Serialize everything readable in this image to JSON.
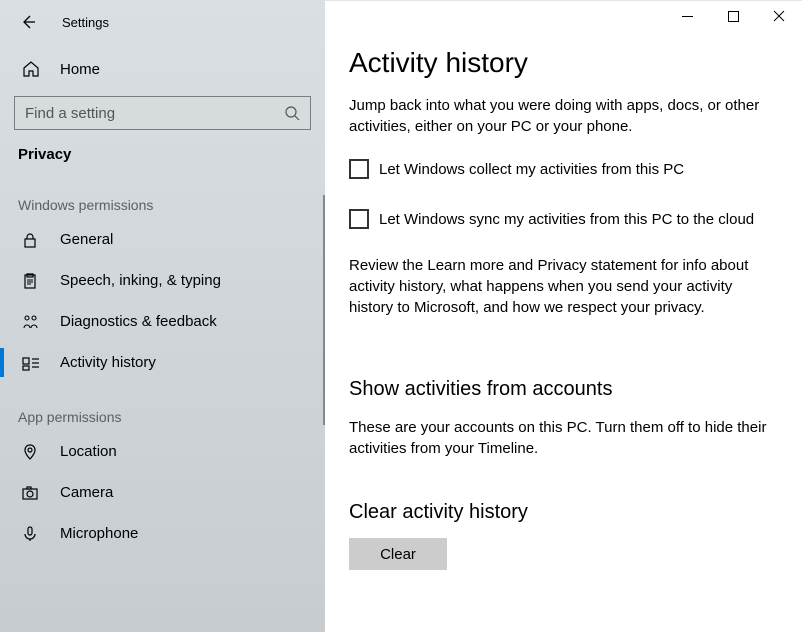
{
  "window": {
    "title": "Settings"
  },
  "sidebar": {
    "home_label": "Home",
    "search_placeholder": "Find a setting",
    "category": "Privacy",
    "groups": [
      {
        "label": "Windows permissions",
        "items": [
          {
            "icon": "lock-icon",
            "label": "General",
            "selected": false
          },
          {
            "icon": "clipboard-icon",
            "label": "Speech, inking, & typing",
            "selected": false
          },
          {
            "icon": "feedback-icon",
            "label": "Diagnostics & feedback",
            "selected": false
          },
          {
            "icon": "activity-icon",
            "label": "Activity history",
            "selected": true
          }
        ]
      },
      {
        "label": "App permissions",
        "items": [
          {
            "icon": "location-icon",
            "label": "Location",
            "selected": false
          },
          {
            "icon": "camera-icon",
            "label": "Camera",
            "selected": false
          },
          {
            "icon": "microphone-icon",
            "label": "Microphone",
            "selected": false
          }
        ]
      }
    ]
  },
  "main": {
    "heading": "Activity history",
    "intro": "Jump back into what you were doing with apps, docs, or other activities, either on your PC or your phone.",
    "check1": "Let Windows collect my activities from this PC",
    "check2": "Let Windows sync my activities from this PC to the cloud",
    "review": "Review the Learn more and Privacy statement for info about activity history, what happens when you send your activity history to Microsoft, and how we respect your privacy.",
    "accounts_heading": "Show activities from accounts",
    "accounts_text": "These are your accounts on this PC. Turn them off to hide their activities from your Timeline.",
    "clear_heading": "Clear activity history",
    "clear_button": "Clear"
  }
}
